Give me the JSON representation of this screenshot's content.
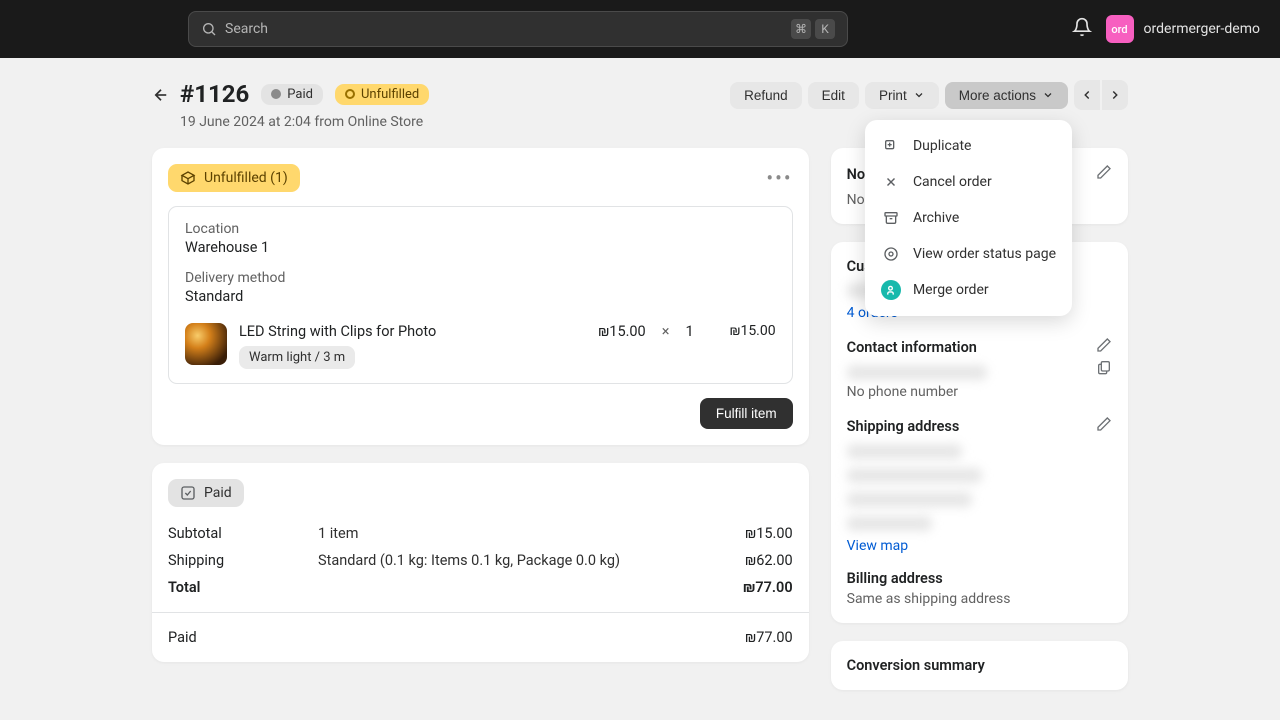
{
  "search": {
    "placeholder": "Search",
    "cmd": "⌘",
    "key": "K"
  },
  "user": {
    "avatar_abbr": "ord",
    "name": "ordermerger-demo"
  },
  "header": {
    "order_number": "#1126",
    "paid_badge": "Paid",
    "fulfillment_badge": "Unfulfilled",
    "subtitle": "19 June 2024 at 2:04 from Online Store"
  },
  "actions": {
    "refund": "Refund",
    "edit": "Edit",
    "print": "Print",
    "more": "More actions"
  },
  "dropdown": {
    "duplicate": "Duplicate",
    "cancel": "Cancel order",
    "archive": "Archive",
    "view_status": "View order status page",
    "merge": "Merge order"
  },
  "fulfill_card": {
    "badge": "Unfulfilled (1)",
    "location_label": "Location",
    "location_value": "Warehouse 1",
    "delivery_label": "Delivery method",
    "delivery_value": "Standard",
    "item": {
      "name": "LED String with Clips for Photo",
      "variant": "Warm light / 3 m",
      "unit_price": "₪15.00",
      "multiply": "×",
      "qty": "1",
      "line_total": "₪15.00"
    },
    "button": "Fulfill item"
  },
  "payment_card": {
    "paid_chip": "Paid",
    "subtotal_label": "Subtotal",
    "subtotal_desc": "1 item",
    "subtotal_amount": "₪15.00",
    "shipping_label": "Shipping",
    "shipping_desc": "Standard (0.1 kg: Items 0.1 kg, Package 0.0 kg)",
    "shipping_amount": "₪62.00",
    "total_label": "Total",
    "total_amount": "₪77.00",
    "paid_label": "Paid",
    "paid_amount": "₪77.00"
  },
  "notes": {
    "title": "Notes",
    "empty": "No notes from customer"
  },
  "customer": {
    "title": "Customer",
    "orders_link": "4 orders",
    "contact_title": "Contact information",
    "no_phone": "No phone number",
    "shipping_title": "Shipping address",
    "view_map": "View map",
    "billing_title": "Billing address",
    "billing_value": "Same as shipping address"
  },
  "conversion": {
    "title": "Conversion summary"
  }
}
